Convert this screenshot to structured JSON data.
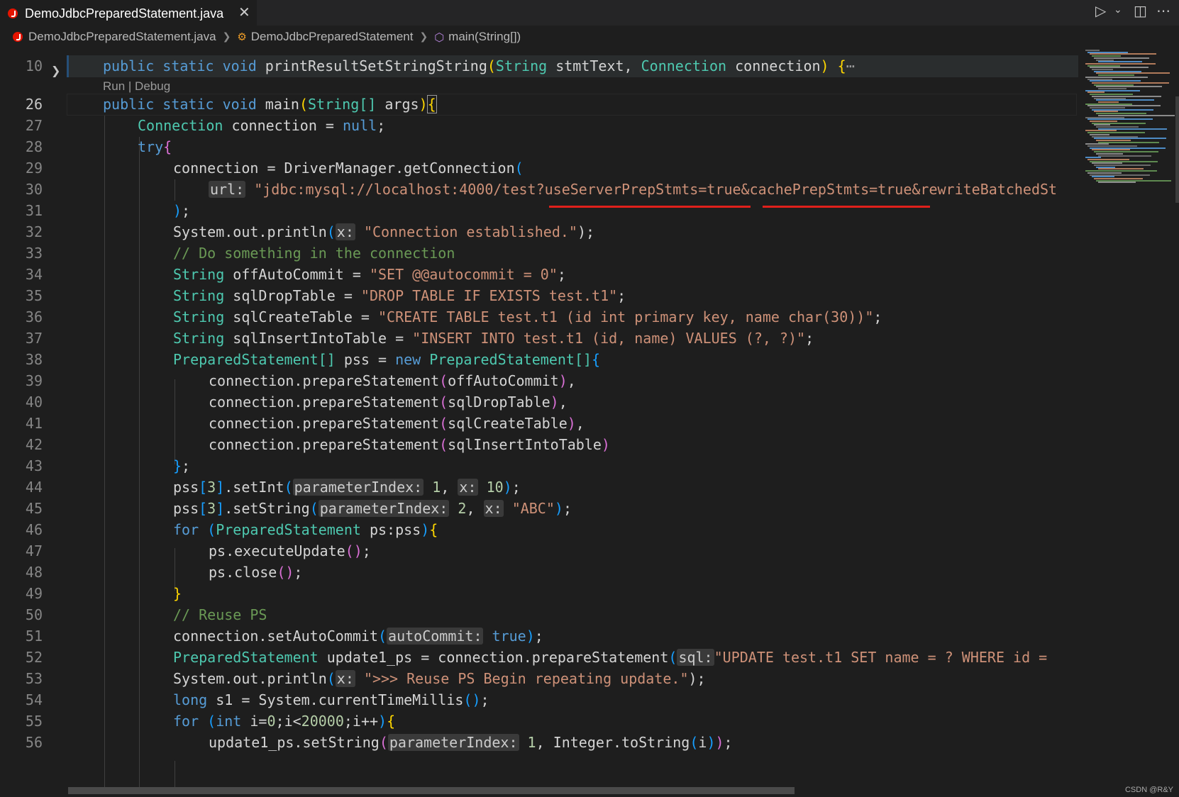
{
  "tab": {
    "filename": "DemoJdbcPreparedStatement.java",
    "close_icon": "close-icon"
  },
  "toolbar": {
    "run_icon": "play-icon",
    "dropdown_icon": "chevron-down-icon",
    "split_icon": "split-editor-icon",
    "more_icon": "more-icon"
  },
  "breadcrumb": {
    "file": "DemoJdbcPreparedStatement.java",
    "class": "DemoJdbcPreparedStatement",
    "method": "main(String[])"
  },
  "codelens": "Run | Debug",
  "line_numbers": [
    "10",
    "26",
    "27",
    "28",
    "29",
    "30",
    "31",
    "32",
    "33",
    "34",
    "35",
    "36",
    "37",
    "38",
    "39",
    "40",
    "41",
    "42",
    "43",
    "44",
    "45",
    "46",
    "47",
    "48",
    "49",
    "50",
    "51",
    "52",
    "53",
    "54",
    "55",
    "56"
  ],
  "code": {
    "l10": {
      "mod": "public static void",
      "name": "printResultSetStringString",
      "p1type": "String",
      "p1": "stmtText,",
      "p2type": "Connection",
      "p2": "connection",
      "ellipsis": "⋯"
    },
    "l26": {
      "mod": "public static void",
      "name": "main",
      "ptype": "String[]",
      "p": "args"
    },
    "l27": {
      "type": "Connection",
      "rest": "connection = ",
      "null": "null",
      "end": ";"
    },
    "l28": {
      "kw": "try"
    },
    "l29": "connection = DriverManager.getConnection",
    "l30": {
      "hint": "url:",
      "str": "\"jdbc:mysql://localhost:4000/test?useServerPrepStmts=true&cachePrepStmts=true&rewriteBatchedSt"
    },
    "l31": ");",
    "l32": {
      "pre": "System.out.println",
      "hint": "x:",
      "str": "\"Connection established.\"",
      "end": ");"
    },
    "l33": "// Do something in the connection",
    "l34": {
      "type": "String",
      "rest": "offAutoCommit = ",
      "str": "\"SET @@autocommit = 0\"",
      "end": ";"
    },
    "l35": {
      "type": "String",
      "rest": "sqlDropTable = ",
      "str": "\"DROP TABLE IF EXISTS test.t1\"",
      "end": ";"
    },
    "l36": {
      "type": "String",
      "rest": "sqlCreateTable = ",
      "str": "\"CREATE TABLE test.t1 (id int primary key, name char(30))\"",
      "end": ";"
    },
    "l37": {
      "type": "String",
      "rest": "sqlInsertIntoTable = ",
      "str": "\"INSERT INTO test.t1 (id, name) VALUES (?, ?)\"",
      "end": ";"
    },
    "l38": {
      "type": "PreparedStatement[]",
      "rest": "pss = ",
      "new": "new",
      "type2": "PreparedStatement[]"
    },
    "l39": {
      "pre": "connection.prepareStatement",
      "arg": "offAutoCommit",
      "end": ","
    },
    "l40": {
      "pre": "connection.prepareStatement",
      "arg": "sqlDropTable",
      "end": ","
    },
    "l41": {
      "pre": "connection.prepareStatement",
      "arg": "sqlCreateTable",
      "end": ","
    },
    "l42": {
      "pre": "connection.prepareStatement",
      "arg": "sqlInsertIntoTable"
    },
    "l43": "};",
    "l44": {
      "pre": "pss",
      "idx": "3",
      "method": ".setInt",
      "hint1": "parameterIndex:",
      "n1": "1",
      "hint2": "x:",
      "n2": "10",
      "end": ";"
    },
    "l45": {
      "pre": "pss",
      "idx": "3",
      "method": ".setString",
      "hint1": "parameterIndex:",
      "n1": "2",
      "hint2": "x:",
      "str": "\"ABC\"",
      "end": ";"
    },
    "l46": {
      "kw": "for",
      "type": "PreparedStatement",
      "rest": "ps:pss"
    },
    "l47": "ps.executeUpdate",
    "l48": "ps.close",
    "l49": "}",
    "l50": "// Reuse PS",
    "l51": {
      "pre": "connection.setAutoCommit",
      "hint": "autoCommit:",
      "val": "true",
      "end": ";"
    },
    "l52": {
      "type": "PreparedStatement",
      "rest": "update1_ps = connection.prepareStatement",
      "hint": "sql:",
      "str": "\"UPDATE test.t1 SET name = ? WHERE id ="
    },
    "l53": {
      "pre": "System.out.println",
      "hint": "x:",
      "str": "\">>> Reuse PS Begin repeating update.\"",
      "end": ");"
    },
    "l54": {
      "kw": "long",
      "rest": "s1 = System.currentTimeMillis",
      "end": ";"
    },
    "l55": {
      "kw": "for",
      "kw2": "int",
      "a": "i=",
      "n0": "0",
      "b": ";i<",
      "n1": "20000",
      "c": ";i++"
    },
    "l56": {
      "pre": "update1_ps.setString",
      "hint": "parameterIndex:",
      "n": "1",
      "mid": "Integer.toString",
      "arg": "i",
      "end": ";"
    }
  },
  "watermark": "CSDN @R&Y",
  "colors": {
    "keyword": "#569cd6",
    "type": "#4ec9b0",
    "string": "#ce9178",
    "number": "#b5cea8",
    "comment": "#6a9955",
    "underline": "#e0201b"
  }
}
